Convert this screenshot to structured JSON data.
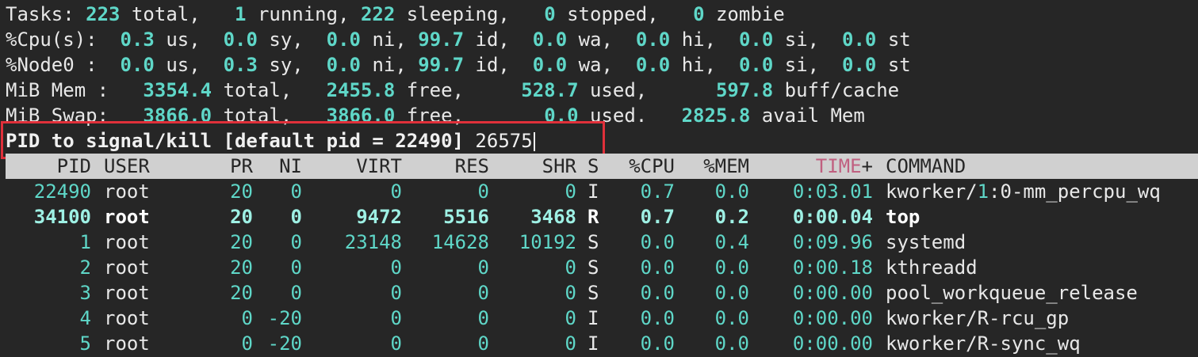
{
  "summary": {
    "tasks": {
      "label": "Tasks:",
      "total": "223",
      "total_lbl": "total,",
      "running": "1",
      "running_lbl": "running,",
      "sleeping": "222",
      "sleeping_lbl": "sleeping,",
      "stopped": "0",
      "stopped_lbl": "stopped,",
      "zombie": "0",
      "zombie_lbl": "zombie"
    },
    "cpu": {
      "label": "%Cpu(s):",
      "us": "0.3",
      "sy": "0.0",
      "ni": "0.0",
      "id": "99.7",
      "wa": "0.0",
      "hi": "0.0",
      "si": "0.0",
      "st": "0.0"
    },
    "node0": {
      "label": "%Node0 :",
      "us": "0.0",
      "sy": "0.3",
      "ni": "0.0",
      "id": "99.7",
      "wa": "0.0",
      "hi": "0.0",
      "si": "0.0",
      "st": "0.0"
    },
    "mem": {
      "label": "MiB Mem :",
      "total": "3354.4",
      "free": "2455.8",
      "used": "528.7",
      "buff": "597.8",
      "total_lbl": "total,",
      "free_lbl": "free,",
      "used_lbl": "used,",
      "buff_lbl": "buff/cache"
    },
    "swap": {
      "label": "MiB Swap:",
      "total": "3866.0",
      "free": "3866.0",
      "used": "0.0",
      "avail": "2825.8",
      "total_lbl": "total,",
      "free_lbl": "free,",
      "used_lbl": "used.",
      "avail_lbl": "avail Mem"
    },
    "cpu_units": {
      "us": "us,",
      "sy": "sy,",
      "ni": "ni,",
      "id": "id,",
      "wa": "wa,",
      "hi": "hi,",
      "si": "si,",
      "st": "st"
    }
  },
  "prompt": {
    "text": "PID to signal/kill [default pid = 22490]",
    "input": "26575"
  },
  "columns": {
    "pid": "PID",
    "user": "USER",
    "pr": "PR",
    "ni": "NI",
    "virt": "VIRT",
    "res": "RES",
    "shr": "SHR",
    "s": "S",
    "cpu": "%CPU",
    "mem": "%MEM",
    "time": "TIME",
    "time_plus": "+",
    "command": "COMMAND"
  },
  "processes": [
    {
      "pid": "22490",
      "user": "root",
      "pr": "20",
      "ni": "0",
      "virt": "0",
      "res": "0",
      "shr": "0",
      "s": "I",
      "cpu": "0.7",
      "mem": "0.0",
      "time": "0:03.01",
      "cmd_a": "kworker/",
      "cmd_b": "1",
      "cmd_c": ":0-mm_percpu_wq"
    },
    {
      "pid": "34100",
      "user": "root",
      "pr": "20",
      "ni": "0",
      "virt": "9472",
      "res": "5516",
      "shr": "3468",
      "s": "R",
      "cpu": "0.7",
      "mem": "0.2",
      "time": "0:00.04",
      "command": "top"
    },
    {
      "pid": "1",
      "user": "root",
      "pr": "20",
      "ni": "0",
      "virt": "23148",
      "res": "14628",
      "shr": "10192",
      "s": "S",
      "cpu": "0.0",
      "mem": "0.4",
      "time": "0:09.96",
      "command": "systemd"
    },
    {
      "pid": "2",
      "user": "root",
      "pr": "20",
      "ni": "0",
      "virt": "0",
      "res": "0",
      "shr": "0",
      "s": "S",
      "cpu": "0.0",
      "mem": "0.0",
      "time": "0:00.18",
      "command": "kthreadd"
    },
    {
      "pid": "3",
      "user": "root",
      "pr": "20",
      "ni": "0",
      "virt": "0",
      "res": "0",
      "shr": "0",
      "s": "S",
      "cpu": "0.0",
      "mem": "0.0",
      "time": "0:00.00",
      "command": "pool_workqueue_release"
    },
    {
      "pid": "4",
      "user": "root",
      "pr": "0",
      "ni": "-20",
      "virt": "0",
      "res": "0",
      "shr": "0",
      "s": "I",
      "cpu": "0.0",
      "mem": "0.0",
      "time": "0:00.00",
      "command": "kworker/R-rcu_gp"
    },
    {
      "pid": "5",
      "user": "root",
      "pr": "0",
      "ni": "-20",
      "virt": "0",
      "res": "0",
      "shr": "0",
      "s": "I",
      "cpu": "0.0",
      "mem": "0.0",
      "time": "0:00.00",
      "command": "kworker/R-sync_wq"
    }
  ],
  "colors": {
    "value": "#5fd7c8",
    "background": "#262626",
    "header_bg": "#d0d0d0",
    "sort_column": "#c06080",
    "highlight_box": "#e0303a"
  }
}
